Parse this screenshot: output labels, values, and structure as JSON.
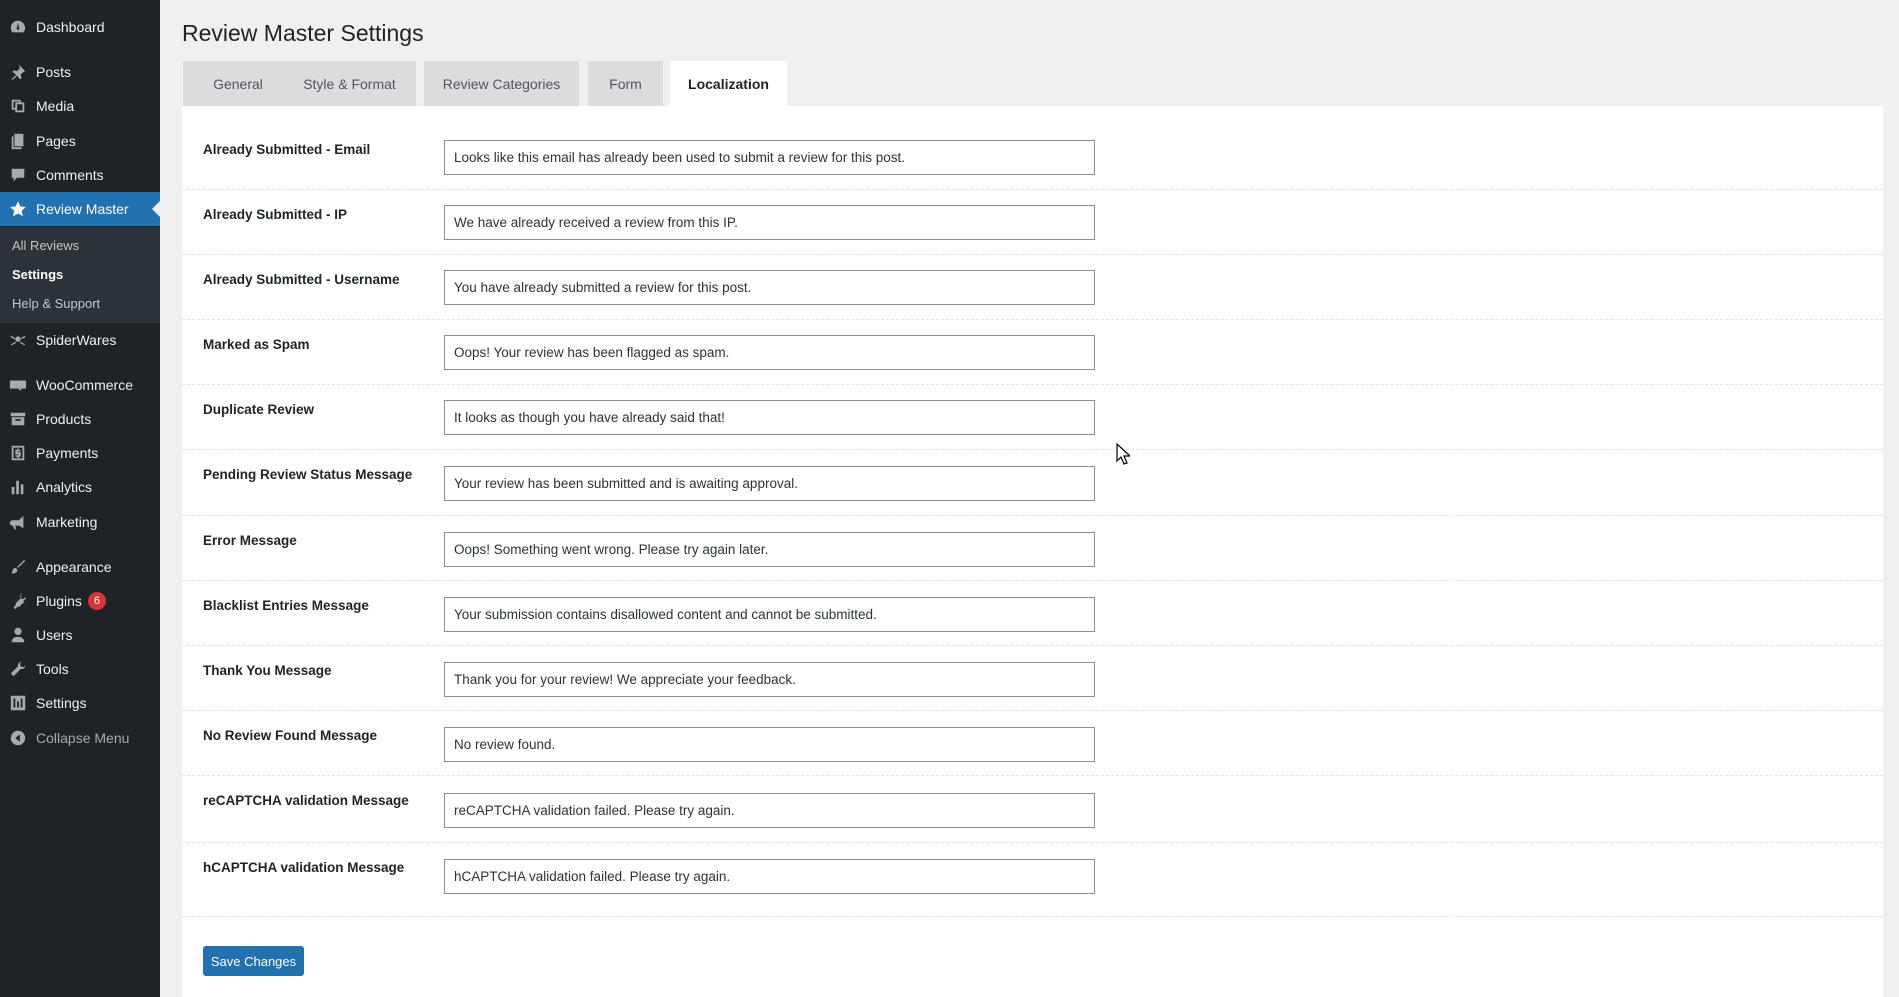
{
  "sidebar": {
    "items": [
      {
        "label": "Dashboard",
        "icon": "dashboard-icon"
      },
      {
        "label": "Posts",
        "icon": "pin-icon"
      },
      {
        "label": "Media",
        "icon": "media-icon"
      },
      {
        "label": "Pages",
        "icon": "pages-icon"
      },
      {
        "label": "Comments",
        "icon": "comment-icon"
      },
      {
        "label": "Review Master",
        "icon": "star-icon"
      },
      {
        "label": "SpiderWares",
        "icon": "spider-icon"
      },
      {
        "label": "WooCommerce",
        "icon": "woo-icon"
      },
      {
        "label": "Products",
        "icon": "archive-icon"
      },
      {
        "label": "Payments",
        "icon": "dollar-icon"
      },
      {
        "label": "Analytics",
        "icon": "bar-chart-icon"
      },
      {
        "label": "Marketing",
        "icon": "megaphone-icon"
      },
      {
        "label": "Appearance",
        "icon": "brush-icon"
      },
      {
        "label": "Plugins",
        "icon": "plug-icon",
        "badge": "6"
      },
      {
        "label": "Users",
        "icon": "user-icon"
      },
      {
        "label": "Tools",
        "icon": "wrench-icon"
      },
      {
        "label": "Settings",
        "icon": "sliders-icon"
      },
      {
        "label": "Collapse Menu",
        "icon": "collapse-icon"
      }
    ],
    "submenu": [
      {
        "label": "All Reviews"
      },
      {
        "label": "Settings"
      },
      {
        "label": "Help & Support"
      }
    ]
  },
  "page": {
    "title": "Review Master Settings"
  },
  "tabs": [
    {
      "label": "General"
    },
    {
      "label": "Style & Format"
    },
    {
      "label": "Review Categories"
    },
    {
      "label": "Form"
    },
    {
      "label": "Localization"
    }
  ],
  "fields": [
    {
      "label": "Already Submitted - Email",
      "value": "Looks like this email has already been used to submit a review for this post."
    },
    {
      "label": "Already Submitted - IP",
      "value": "We have already received a review from this IP."
    },
    {
      "label": "Already Submitted - Username",
      "value": "You have already submitted a review for this post."
    },
    {
      "label": "Marked as Spam",
      "value": "Oops! Your review has been flagged as spam."
    },
    {
      "label": "Duplicate Review",
      "value": "It looks as though you have already said that!"
    },
    {
      "label": "Pending Review Status Message",
      "value": "Your review has been submitted and is awaiting approval."
    },
    {
      "label": "Error Message",
      "value": "Oops! Something went wrong. Please try again later."
    },
    {
      "label": "Blacklist Entries Message",
      "value": "Your submission contains disallowed content and cannot be submitted."
    },
    {
      "label": "Thank You Message",
      "value": "Thank you for your review! We appreciate your feedback."
    },
    {
      "label": "No Review Found Message",
      "value": "No review found."
    },
    {
      "label": "reCAPTCHA validation Message",
      "value": "reCAPTCHA validation failed. Please try again."
    },
    {
      "label": "hCAPTCHA validation Message",
      "value": "hCAPTCHA validation failed. Please try again."
    }
  ],
  "actions": {
    "save_label": "Save Changes"
  },
  "colors": {
    "sidebar": "#1d2327",
    "accent": "#2271b1",
    "badge": "#d63638"
  }
}
